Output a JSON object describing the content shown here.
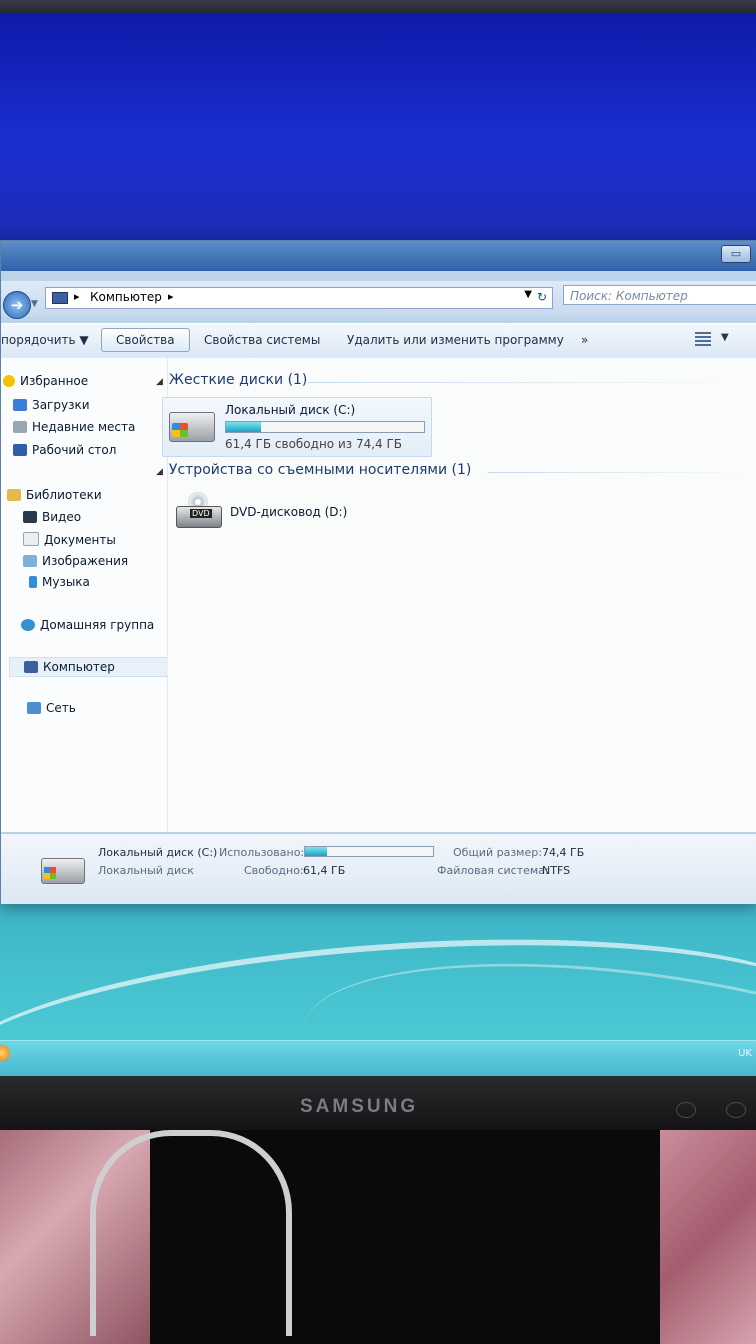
{
  "monitor": {
    "brand": "SAMSUNG"
  },
  "taskbar": {
    "tray_text": "UK"
  },
  "window": {
    "address": {
      "crumb": "Компьютер",
      "search_placeholder": "Поиск: Компьютер"
    },
    "toolbar": {
      "organize": "порядочить ▼",
      "properties": "Свойства",
      "system_properties": "Свойства системы",
      "uninstall": "Удалить или изменить программу",
      "more": "»"
    },
    "nav": {
      "favorites": "Избранное",
      "downloads": "Загрузки",
      "recent": "Недавние места",
      "desktop": "Рабочий стол",
      "libraries": "Библиотеки",
      "video": "Видео",
      "documents": "Документы",
      "pictures": "Изображения",
      "music": "Музыка",
      "homegroup": "Домашняя группа",
      "computer": "Компьютер",
      "network": "Сеть"
    },
    "content": {
      "hdd_group": "Жесткие диски (1)",
      "drive_c": {
        "name": "Локальный диск (C:)",
        "free_text": "61,4 ГБ свободно из 74,4 ГБ",
        "used_fraction": 0.175
      },
      "removable_group": "Устройства со съемными носителями (1)",
      "drive_d": {
        "name": "DVD-дисковод (D:)"
      }
    },
    "details": {
      "name": "Локальный диск (C:)",
      "type": "Локальный диск",
      "used_label": "Использовано:",
      "free_label": "Свободно:",
      "free_value": "61,4 ГБ",
      "total_label": "Общий размер:",
      "total_value": "74,4 ГБ",
      "fs_label": "Файловая система:",
      "fs_value": "NTFS"
    }
  },
  "colors": {
    "accent": "#2f62a8",
    "bar_fill": "#1aa3c2"
  }
}
